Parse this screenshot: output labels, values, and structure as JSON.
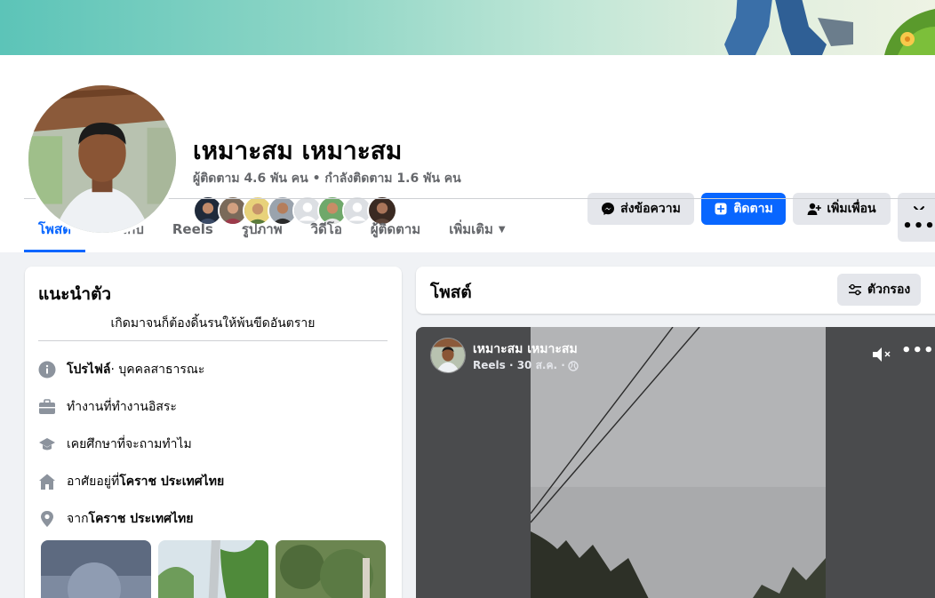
{
  "profile": {
    "name": "เหมาะสม เหมาะสม",
    "follow_stats": "ผู้ติดตาม 4.6 พัน คน • กำลังติดตาม 1.6 พัน คน"
  },
  "actions": {
    "message_label": "ส่งข้อความ",
    "follow_label": "ติดตาม",
    "add_friend_label": "เพิ่มเพื่อน"
  },
  "tabs": [
    {
      "label": "โพสต์",
      "active": true
    },
    {
      "label": "เกี่ยวกับ"
    },
    {
      "label": "Reels"
    },
    {
      "label": "รูปภาพ"
    },
    {
      "label": "วิดีโอ"
    },
    {
      "label": "ผู้ติดตาม"
    },
    {
      "label": "เพิ่มเติม"
    }
  ],
  "more_button": "•••",
  "intro": {
    "title": "แนะนำตัว",
    "bio": "เกิดมาจนก็ต้องดิ้นรนให้พ้นขีดอันตราย",
    "profile_label": "โปรไฟล์",
    "profile_value": " · บุคคลสาธารณะ",
    "work_prefix": "ทำงานที่ ",
    "work_value": "ทำงานอิสระ",
    "study_prefix": "เคยศึกษาที่ ",
    "study_value": "จะถามทำไม",
    "lives_prefix": "อาศัยอยู่ที่ ",
    "lives_value": "โคราช ประเทศไทย",
    "from_prefix": "จาก ",
    "from_value": "โคราช ประเทศไทย"
  },
  "posts": {
    "title": "โพสต์",
    "filter_label": "ตัวกรอง"
  },
  "reel": {
    "author": "เหมาะสม เหมาะสม",
    "meta": "Reels · 30 ส.ค. ·",
    "menu": "•••"
  },
  "colors": {
    "accent": "#0866ff",
    "button_grey": "#e4e6eb",
    "muted_text": "#65676b"
  }
}
